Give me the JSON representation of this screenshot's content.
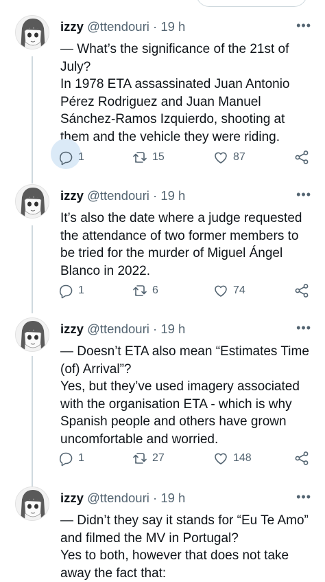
{
  "tweets": [
    {
      "name": "izzy",
      "handle": "@ttendouri",
      "dot": "·",
      "time": "19 h",
      "lines": [
        "— What’s the significance of the 21st of July?",
        "In 1978 ETA assassinated Juan Antonio Pérez Rodriguez and Juan Manuel Sánchez-Ramos Izquierdo, shooting at them and the vehicle they were riding."
      ],
      "replies": "1",
      "retweets": "15",
      "likes": "87"
    },
    {
      "name": "izzy",
      "handle": "@ttendouri",
      "dot": "·",
      "time": "19 h",
      "lines": [
        "It’s also the date where a judge requested the attendance of two former members to be tried for the murder of Miguel Ángel Blanco in 2022."
      ],
      "replies": "1",
      "retweets": "6",
      "likes": "74"
    },
    {
      "name": "izzy",
      "handle": "@ttendouri",
      "dot": "·",
      "time": "19 h",
      "lines": [
        "— Doesn’t ETA also mean “Estimates Time (of) Arrival”?",
        "Yes, but they’ve used imagery associated with the organisation ETA - which is why Spanish people and others have grown uncomfortable and worried."
      ],
      "replies": "1",
      "retweets": "27",
      "likes": "148"
    },
    {
      "name": "izzy",
      "handle": "@ttendouri",
      "dot": "·",
      "time": "19 h",
      "lines": [
        "— Didn’t they say it stands for “Eu Te Amo” and filmed the MV in Portugal?",
        "Yes to both, however that does not take away the fact that:"
      ]
    }
  ],
  "icons": {
    "more": "more-dots-icon",
    "reply": "reply-icon",
    "retweet": "retweet-icon",
    "like": "heart-icon",
    "share": "share-icon"
  },
  "colors": {
    "text": "#0f1419",
    "secondary": "#536471",
    "reply_highlight": "#dbeaf7",
    "thread_line": "#cfd9de"
  }
}
